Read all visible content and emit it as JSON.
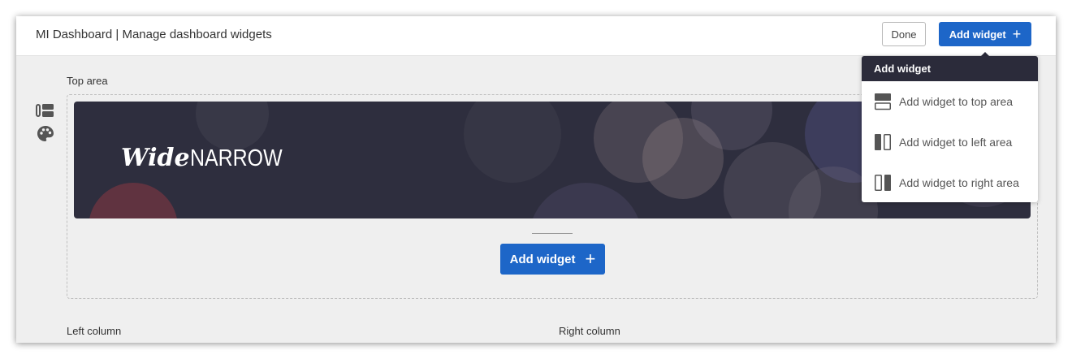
{
  "header": {
    "title": "MI Dashboard | Manage dashboard widgets",
    "done_label": "Done",
    "add_widget_label": "Add widget"
  },
  "sidebar": {
    "icons": [
      "layout-icon",
      "palette-icon"
    ]
  },
  "main": {
    "top_area_label": "Top area",
    "banner": {
      "brand_wide": "Wide",
      "brand_narrow": "NARROW"
    },
    "add_widget_label": "Add widget",
    "left_column_label": "Left column",
    "right_column_label": "Right column"
  },
  "dropdown": {
    "header": "Add widget",
    "items": [
      {
        "label": "Add widget to top area",
        "icon": "top-area-icon"
      },
      {
        "label": "Add widget to left area",
        "icon": "left-area-icon"
      },
      {
        "label": "Add widget to right area",
        "icon": "right-area-icon"
      }
    ]
  },
  "colors": {
    "primary": "#1d66c8",
    "dark": "#2b2b3a",
    "background": "#efefef"
  }
}
